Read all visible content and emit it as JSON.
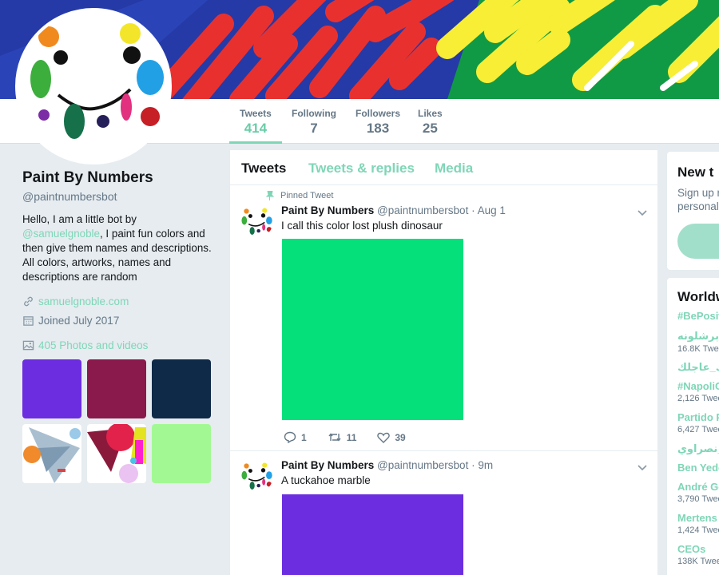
{
  "nav": {
    "stats": [
      {
        "label": "Tweets",
        "value": "414"
      },
      {
        "label": "Following",
        "value": "7"
      },
      {
        "label": "Followers",
        "value": "183"
      },
      {
        "label": "Likes",
        "value": "25"
      }
    ]
  },
  "profile": {
    "name": "Paint By Numbers",
    "handle": "@paintnumbersbot",
    "bio_before": "Hello, I am a little bot by ",
    "bio_mention": "@samuelgnoble",
    "bio_after": ", I paint fun colors and then give them names and descriptions. All colors, artworks, names and descriptions are random",
    "website": "samuelgnoble.com",
    "joined": "Joined July 2017",
    "photos_label": "405 Photos and videos"
  },
  "photos": [
    {
      "kind": "solid",
      "color": "#6b2ddf"
    },
    {
      "kind": "solid",
      "color": "#8a1a4c"
    },
    {
      "kind": "solid",
      "color": "#0f2a48"
    },
    {
      "kind": "art1"
    },
    {
      "kind": "art2"
    },
    {
      "kind": "solid",
      "color": "#a2f994"
    }
  ],
  "tabs": [
    "Tweets",
    "Tweets & replies",
    "Media"
  ],
  "tweets": [
    {
      "pinned_label": "Pinned Tweet",
      "name": "Paint By Numbers",
      "handle": "@paintnumbersbot",
      "dot": "·",
      "time": "Aug 1",
      "text": "I call this color lost plush dinosaur",
      "color": "#06e07b",
      "replies": "1",
      "retweets": "11",
      "likes": "39"
    },
    {
      "name": "Paint By Numbers",
      "handle": "@paintnumbersbot",
      "dot": "·",
      "time": "9m",
      "text": "A tuckahoe marble",
      "color": "#6b2ddf"
    }
  ],
  "right": {
    "new_title": "New t",
    "new_sub_1": "Sign up n",
    "new_sub_2": "personali",
    "trends_title": "Worldw",
    "trends": [
      {
        "name": "#BePosit",
        "count": ""
      },
      {
        "name": "د_برشلونه",
        "count": "16.8K Twee"
      },
      {
        "name": "لك_عاجلك",
        "count": ""
      },
      {
        "name": "#NapoliC",
        "count": "2,126 Twee"
      },
      {
        "name": "Partido P",
        "count": "6,427 Twee"
      },
      {
        "name": "ي_نصراوي",
        "count": ""
      },
      {
        "name": "Ben Yedo",
        "count": ""
      },
      {
        "name": "André Go",
        "count": "3,790 Twee"
      },
      {
        "name": "Mertens",
        "count": "1,424 Twee"
      },
      {
        "name": "CEOs",
        "count": "138K Twee"
      }
    ]
  },
  "colors": {
    "accent": "#7fd6b7",
    "banner_blue": "#253aa6",
    "banner_red": "#e8312f",
    "banner_yellow": "#f7ee35",
    "banner_green": "#119a45"
  }
}
